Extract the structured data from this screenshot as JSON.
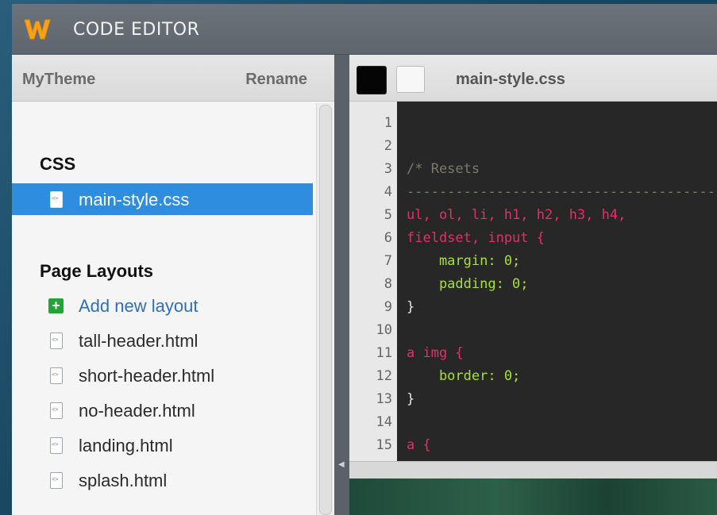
{
  "app": {
    "title": "CODE EDITOR",
    "logo_icon": "weebly-w-logo",
    "logo_letter": "W"
  },
  "sidebar": {
    "theme_name": "MyTheme",
    "rename_label": "Rename",
    "sections": [
      {
        "title": "CSS",
        "files": [
          {
            "label": "main-style.css",
            "selected": true
          }
        ]
      },
      {
        "title": "Page Layouts",
        "add_label": "Add new layout",
        "files": [
          {
            "label": "tall-header.html"
          },
          {
            "label": "short-header.html"
          },
          {
            "label": "no-header.html"
          },
          {
            "label": "landing.html"
          },
          {
            "label": "splash.html"
          }
        ]
      }
    ]
  },
  "editor": {
    "tab_title": "main-style.css",
    "theme_swatches": [
      "#050505",
      "#f7f7f7"
    ],
    "line_numbers": [
      "1",
      "2",
      "3",
      "4",
      "5",
      "6",
      "7",
      "8",
      "9",
      "10",
      "11",
      "12",
      "13",
      "14",
      "15"
    ],
    "code": [
      "",
      "",
      "/* Resets",
      "------------------------------------------------",
      "ul, ol, li, h1, h2, h3, h4,",
      "fieldset, input {",
      "    margin: 0;",
      "    padding: 0;",
      "}",
      "",
      "a img {",
      "    border: 0;",
      "}",
      "",
      "a {"
    ]
  },
  "colors": {
    "accent_selected": "#2f8de0",
    "add_button": "#21a336",
    "selector": "#e52f65",
    "property": "#a6e22e",
    "number": "#9b7fe6",
    "comment": "#7a7a6a"
  }
}
